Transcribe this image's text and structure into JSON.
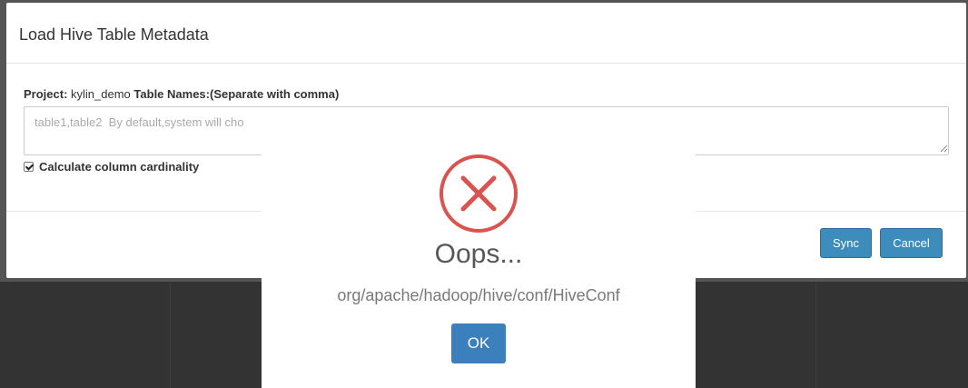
{
  "modal": {
    "title": "Load Hive Table Metadata",
    "project_label": "Project:",
    "project_value": "kylin_demo",
    "table_names_label": "Table Names:(Separate with comma)",
    "table_names_placeholder": "table1,table2  By default,system will cho",
    "cardinality_label": "Calculate column cardinality",
    "cardinality_checked": true,
    "sync_label": "Sync",
    "cancel_label": "Cancel"
  },
  "alert": {
    "icon": "error-x-icon",
    "title": "Oops...",
    "message": "org/apache/hadoop/hive/conf/HiveConf",
    "ok_label": "OK",
    "icon_color": "#d9534f"
  },
  "colors": {
    "primary_button": "#3c8dbc",
    "backdrop": "#333333"
  }
}
